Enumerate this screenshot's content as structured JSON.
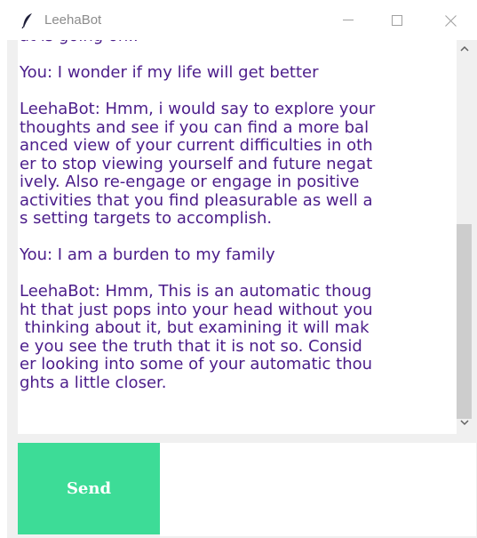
{
  "window": {
    "title": "LeehaBot",
    "icon": "feather-icon",
    "controls": [
      "minimize-icon",
      "maximize-icon",
      "close-icon"
    ]
  },
  "chat": {
    "lines": [
      "at is going on..",
      "",
      "You: I wonder if my life will get better",
      "",
      "LeehaBot: Hmm, i would say to explore your",
      "thoughts and see if you can find a more bal",
      "anced view of your current difficulties in oth",
      "er to stop viewing yourself and future negat",
      "ively. Also re-engage or engage in positive",
      "activities that you find pleasurable as well a",
      "s setting targets to accomplish.",
      "",
      "You: I am a burden to my family",
      "",
      "LeehaBot: Hmm, This is an automatic thoug",
      "ht that just pops into your head without you",
      " thinking about it, but examining it will mak",
      "e you see the truth that it is not so. Consid",
      "er looking into some of your automatic thou",
      "ghts a little closer."
    ],
    "scroll_position": 0.5
  },
  "input": {
    "send_label": "Send",
    "value": ""
  },
  "colors": {
    "text": "#4b1d8a",
    "send_bg": "#3ddc97",
    "send_text": "#ffffff"
  }
}
